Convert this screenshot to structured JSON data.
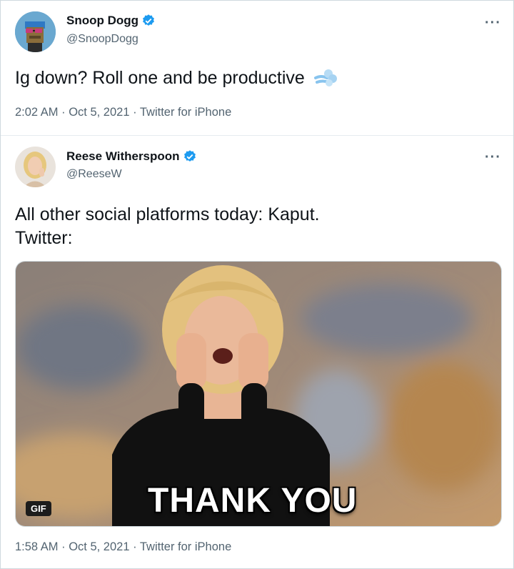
{
  "tweets": [
    {
      "name": "Snoop Dogg",
      "handle": "@SnoopDogg",
      "text": "Ig down? Roll one and be productive",
      "emoji": "dash-symbol-icon",
      "meta": "2:02 AM · Oct 5, 2021 · Twitter for iPhone",
      "more": "···"
    },
    {
      "name": "Reese Witherspoon",
      "handle": "@ReeseW",
      "text_line1": "All other social platforms today: Kaput.",
      "text_line2": "Twitter:",
      "media": {
        "badge": "GIF",
        "caption": "THANK YOU"
      },
      "meta": "1:58 AM · Oct 5, 2021 · Twitter for iPhone",
      "more": "···"
    }
  ],
  "colors": {
    "verified": "#1d9bf0",
    "secondary_text": "#536471",
    "border": "#cfd9de"
  }
}
